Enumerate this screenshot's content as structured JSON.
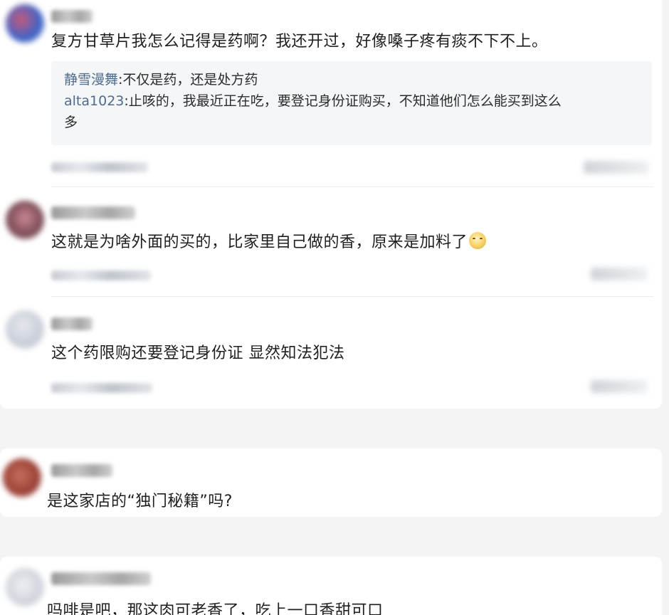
{
  "thread": {
    "comments": [
      {
        "text": "复方甘草片我怎么记得是药啊？我还开过，好像嗓子疼有痰不下不上。",
        "replies": [
          {
            "name": "静雪漫舞",
            "text": ":不仅是药，还是处方药"
          },
          {
            "name": "alta1023",
            "text": ":止咳的，我最近正在吃，要登记身份证购买，不知道他们怎么能买到这么"
          },
          {
            "name": "",
            "text": "多"
          }
        ]
      },
      {
        "text": "这就是为啥外面的买的，比家里自己做的香，原来是加料了",
        "emoji_icon": "smiling-face-emoji"
      },
      {
        "text": "这个药限购还要登记身份证 显然知法犯法"
      },
      {
        "text": "是这家店的“独门秘籍”吗?"
      },
      {
        "text": "吗啡是吧，那这肉可老香了，吃上一口香甜可口"
      }
    ]
  },
  "colors": {
    "background": "#f4f4f5",
    "card": "#ffffff",
    "reply_box": "#f5f6f8",
    "reply_name": "#4f6b8e",
    "text": "#1f1f1f"
  }
}
